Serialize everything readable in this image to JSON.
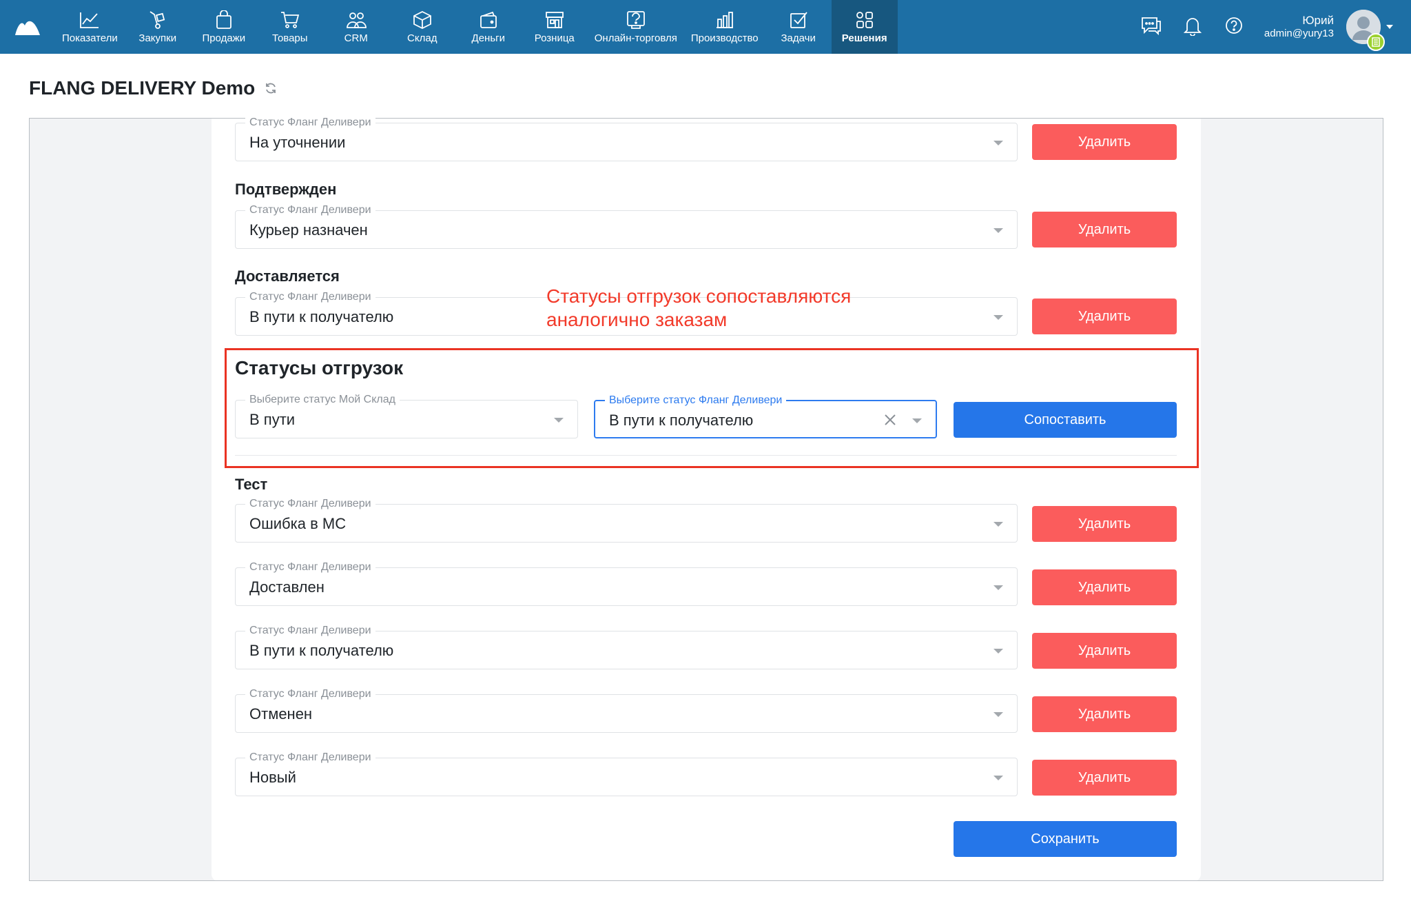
{
  "nav": {
    "items": [
      {
        "label": "Показатели",
        "icon": "chart-line-icon"
      },
      {
        "label": "Закупки",
        "icon": "hand-truck-icon"
      },
      {
        "label": "Продажи",
        "icon": "shopping-bag-icon"
      },
      {
        "label": "Товары",
        "icon": "cart-icon"
      },
      {
        "label": "CRM",
        "icon": "users-icon"
      },
      {
        "label": "Склад",
        "icon": "box-icon"
      },
      {
        "label": "Деньги",
        "icon": "wallet-icon"
      },
      {
        "label": "Розница",
        "icon": "store-icon"
      },
      {
        "label": "Онлайн-торговля",
        "icon": "online-store-icon"
      },
      {
        "label": "Производство",
        "icon": "factory-icon"
      },
      {
        "label": "Задачи",
        "icon": "checkbox-icon"
      },
      {
        "label": "Решения",
        "icon": "apps-icon",
        "active": true
      }
    ]
  },
  "user": {
    "name": "Юрий",
    "login": "admin@yury13"
  },
  "page": {
    "title": "FLANG DELIVERY Demo"
  },
  "form": {
    "field_label": "Статус Фланг Деливери",
    "delete_label": "Удалить",
    "rows_top": [
      {
        "value": "На уточнении"
      },
      {
        "group": "Подтвержден",
        "value": "Курьер назначен"
      },
      {
        "group": "Доставляется",
        "value": "В пути к получателю"
      }
    ],
    "shipments": {
      "title": "Статусы отгрузок",
      "moysklad_label": "Выберите статус Мой Склад",
      "moysklad_value": "В пути",
      "flang_label": "Выберите статус Фланг Деливери",
      "flang_value": "В пути к получателю",
      "map_button": "Сопоставить"
    },
    "test_group": "Тест",
    "rows_bottom": [
      {
        "value": "Ошибка в МС"
      },
      {
        "value": "Доставлен"
      },
      {
        "value": "В пути к получателю"
      },
      {
        "value": "Отменен"
      },
      {
        "value": "Новый"
      }
    ],
    "save_label": "Сохранить"
  },
  "annotation": {
    "line1": "Статусы отгрузок сопоставляются",
    "line2": "аналогично заказам"
  },
  "colors": {
    "topbar": "#1d6fa5",
    "delete": "#fb5c5c",
    "primary": "#2576e9",
    "annotation": "#ea3323"
  }
}
